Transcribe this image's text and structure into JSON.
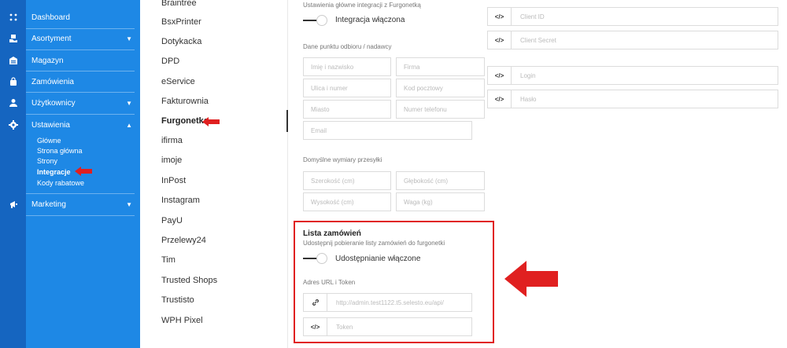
{
  "nav": {
    "items": [
      {
        "label": "Dashboard"
      },
      {
        "label": "Asortyment",
        "chevron": "▼"
      },
      {
        "label": "Magazyn"
      },
      {
        "label": "Zamówienia"
      },
      {
        "label": "Użytkownicy",
        "chevron": "▼"
      },
      {
        "label": "Ustawienia",
        "chevron": "▲"
      },
      {
        "label": "Marketing",
        "chevron": "▼"
      }
    ],
    "subitems": [
      "Główne",
      "Strona główna",
      "Strony",
      "Integracje",
      "Kody rabatowe"
    ],
    "active_sub": "Integracje"
  },
  "integrations": {
    "items": [
      "Braintree",
      "BsxPrinter",
      "Dotykacka",
      "DPD",
      "eService",
      "Fakturownia",
      "Furgonetka",
      "ifirma",
      "imoje",
      "InPost",
      "Instagram",
      "PayU",
      "Przelewy24",
      "Tim",
      "Trusted Shops",
      "Trustisto",
      "WPH Pixel"
    ],
    "active": "Furgonetka"
  },
  "form": {
    "main_label": "Ustawienia główne integracji z Furgonetką",
    "main_toggle": "Integracja włączona",
    "pickup_label": "Dane punktu odbioru / nadawcy",
    "fields": {
      "name": "Imię i nazwisko",
      "company": "Firma",
      "street": "Ulica i numer",
      "postcode": "Kod pocztowy",
      "city": "Miasto",
      "phone": "Numer telefonu",
      "email": "Email"
    },
    "dimensions_label": "Domyślne wymiary przesyłki",
    "dimensions": {
      "width": "Szerokość (cm)",
      "depth": "Głębokość (cm)",
      "height": "Wysokość (cm)",
      "weight": "Waga (kg)"
    },
    "credentials": {
      "client_id": "Client ID",
      "client_secret": "Client Secret",
      "login": "Login",
      "password": "Hasło"
    },
    "orders": {
      "title": "Lista zamówień",
      "description": "Udostępnij pobieranie listy zamówień do furgonetki",
      "toggle": "Udostępnianie włączone",
      "url_label": "Adres URL i Token",
      "url_placeholder": "http://admin.test1122.t5.selesto.eu/api/",
      "token_placeholder": "Token"
    }
  },
  "icons": {
    "code": "</>",
    "link": "link-icon"
  },
  "colors": {
    "rail": "#1565c0",
    "nav": "#1e88e5",
    "highlight": "#e02020"
  }
}
